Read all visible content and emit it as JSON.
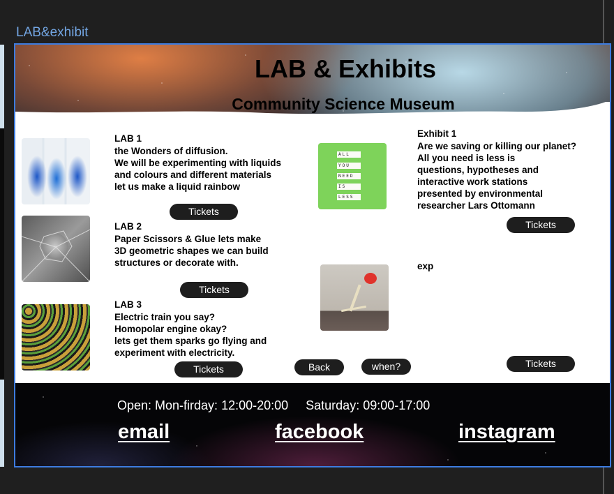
{
  "canvas": {
    "frame_label": "LAB&exhibit"
  },
  "header": {
    "title": "LAB & Exhibits",
    "subtitle": "Community Science Museum"
  },
  "labs": [
    {
      "heading": "LAB 1",
      "description": "the Wonders of diffusion.\nWe will be experimenting with liquids\nand colours and different materials\nlet us make a liquid rainbow",
      "button": "Tickets",
      "image": "blue-ink-in-water-glasses"
    },
    {
      "heading": "LAB 2",
      "description": "Paper Scissors & Glue lets make\n3D geometric shapes we can build\nstructures or decorate with.",
      "button": "Tickets",
      "image": "paper-polyhedron"
    },
    {
      "heading": "LAB 3",
      "description": "Electric train you say?\nHomopolar engine  okay?\nlets get them sparks go flying and\nexperiment with electricity.",
      "button": "Tickets",
      "image": "batteries"
    }
  ],
  "exhibits": [
    {
      "heading": "Exhibit 1",
      "description": "Are we saving or killing our planet?\nAll you need is less is\nquestions, hypotheses and\ninteractive work stations\npresented by environmental\nresearcher Lars Ottomann",
      "button": "Tickets",
      "image": "letter-tiles",
      "tiles": [
        "ALL",
        "YOU",
        "NEED",
        "IS",
        "LESS"
      ]
    },
    {
      "heading": "exp",
      "button": "Tickets",
      "image": "skeleton-figure"
    }
  ],
  "nav": {
    "back_label": "Back",
    "when_label": "when?"
  },
  "footer": {
    "hours": "Open: Mon-firday: 12:00-20:00     Saturday: 09:00-17:00",
    "links": [
      "email",
      "facebook",
      "instagram"
    ]
  },
  "colors": {
    "frame_outline": "#3d7ce0",
    "button_bg": "#1e1e1e",
    "canvas_bg": "#1f1f1f",
    "frame_label": "#73a6e3"
  }
}
